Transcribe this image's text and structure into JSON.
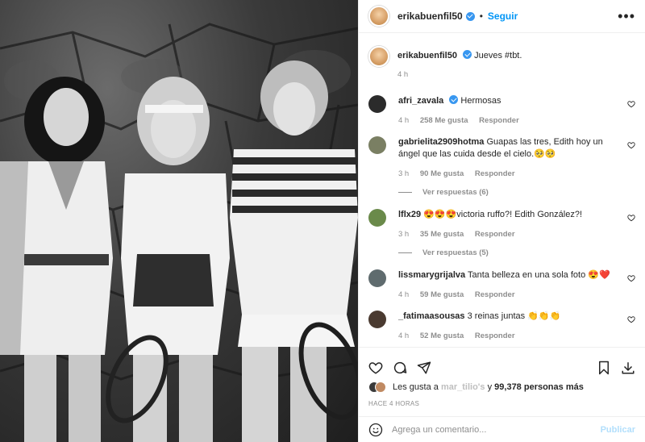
{
  "header": {
    "username": "erikabuenfil50",
    "follow_label": "Seguir",
    "dot": "•",
    "more": "•••"
  },
  "caption": {
    "username": "erikabuenfil50",
    "text": "Jueves #tbt.",
    "time": "4 h"
  },
  "comments": [
    {
      "user": "afri_zavala",
      "verified": true,
      "text": "Hermosas",
      "time": "4 h",
      "likes": "258 Me gusta",
      "reply": "Responder",
      "avatar_color": "#2b2b2b"
    },
    {
      "user": "gabrielita2909hotma",
      "verified": false,
      "text": "Guapas las tres, Edith hoy un ángel que las cuida desde el cielo.🥺🥺",
      "time": "3 h",
      "likes": "90 Me gusta",
      "reply": "Responder",
      "view_replies": "Ver respuestas (6)",
      "avatar_color": "#7a7f63"
    },
    {
      "user": "lflx29",
      "verified": false,
      "text": "😍😍😍victoria ruffo?! Edith González?!",
      "time": "3 h",
      "likes": "35 Me gusta",
      "reply": "Responder",
      "view_replies": "Ver respuestas (5)",
      "avatar_color": "#6a8a4a"
    },
    {
      "user": "lissmarygrijalva",
      "verified": false,
      "text": "Tanta belleza en una sola foto 😍❤️",
      "time": "4 h",
      "likes": "59 Me gusta",
      "reply": "Responder",
      "avatar_color": "#5f6b6e"
    },
    {
      "user": "_fatimaasousas",
      "verified": false,
      "text": "3 reinas juntas 👏👏👏",
      "time": "4 h",
      "likes": "52 Me gusta",
      "reply": "Responder",
      "avatar_color": "#4a3a30"
    }
  ],
  "likes": {
    "prefix": "Les gusta a ",
    "blurred": "mar_tilio's",
    "middle": " y ",
    "count": "99,378 personas más"
  },
  "posted_ago": "HACE 4 HORAS",
  "add_comment": {
    "placeholder": "Agrega un comentario...",
    "post_label": "Publicar"
  }
}
